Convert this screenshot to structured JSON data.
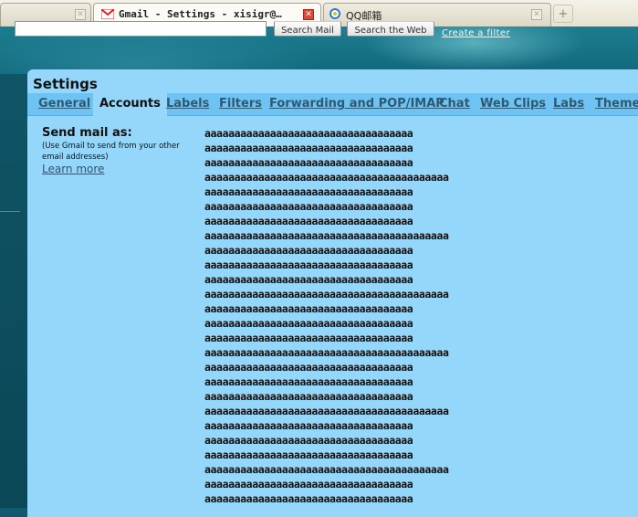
{
  "browser": {
    "tabs": [
      {
        "title": "Gmail - Settings - xisigr@…",
        "active": true
      },
      {
        "title": "QQ邮箱",
        "active": false
      }
    ],
    "new_tab_glyph": "+"
  },
  "header": {
    "search_mail_label": "Search Mail",
    "search_web_label": "Search the Web",
    "create_filter_label": "Create a filter"
  },
  "settings": {
    "title": "Settings",
    "tabs": [
      "General",
      "Accounts",
      "Labels",
      "Filters",
      "Forwarding and POP/IMAP",
      "Chat",
      "Web Clips",
      "Labs",
      "Themes"
    ],
    "active_tab": "Accounts"
  },
  "send_mail_as": {
    "heading": "Send mail as:",
    "note": "(Use Gmail to send from your other email addresses)",
    "learn_more": "Learn more",
    "addresses": [
      "aaaaaaaaaaaaaaaaaaaaaaaaaaaaaaaaaaa",
      "aaaaaaaaaaaaaaaaaaaaaaaaaaaaaaaaaaa",
      "aaaaaaaaaaaaaaaaaaaaaaaaaaaaaaaaaaa",
      "aaaaaaaaaaaaaaaaaaaaaaaaaaaaaaaaaaaaaaaaa",
      "aaaaaaaaaaaaaaaaaaaaaaaaaaaaaaaaaaa",
      "aaaaaaaaaaaaaaaaaaaaaaaaaaaaaaaaaaa",
      "aaaaaaaaaaaaaaaaaaaaaaaaaaaaaaaaaaa",
      "aaaaaaaaaaaaaaaaaaaaaaaaaaaaaaaaaaaaaaaaa",
      "aaaaaaaaaaaaaaaaaaaaaaaaaaaaaaaaaaa",
      "aaaaaaaaaaaaaaaaaaaaaaaaaaaaaaaaaaa",
      "aaaaaaaaaaaaaaaaaaaaaaaaaaaaaaaaaaa",
      "aaaaaaaaaaaaaaaaaaaaaaaaaaaaaaaaaaaaaaaaa",
      "aaaaaaaaaaaaaaaaaaaaaaaaaaaaaaaaaaa",
      "aaaaaaaaaaaaaaaaaaaaaaaaaaaaaaaaaaa",
      "aaaaaaaaaaaaaaaaaaaaaaaaaaaaaaaaaaa",
      "aaaaaaaaaaaaaaaaaaaaaaaaaaaaaaaaaaaaaaaaa",
      "aaaaaaaaaaaaaaaaaaaaaaaaaaaaaaaaaaa",
      "aaaaaaaaaaaaaaaaaaaaaaaaaaaaaaaaaaa",
      "aaaaaaaaaaaaaaaaaaaaaaaaaaaaaaaaaaa",
      "aaaaaaaaaaaaaaaaaaaaaaaaaaaaaaaaaaaaaaaaa",
      "aaaaaaaaaaaaaaaaaaaaaaaaaaaaaaaaaaa",
      "aaaaaaaaaaaaaaaaaaaaaaaaaaaaaaaaaaa",
      "aaaaaaaaaaaaaaaaaaaaaaaaaaaaaaaaaaa",
      "aaaaaaaaaaaaaaaaaaaaaaaaaaaaaaaaaaaaaaaaa",
      "aaaaaaaaaaaaaaaaaaaaaaaaaaaaaaaaaaa",
      "aaaaaaaaaaaaaaaaaaaaaaaaaaaaaaaaaaa"
    ]
  }
}
